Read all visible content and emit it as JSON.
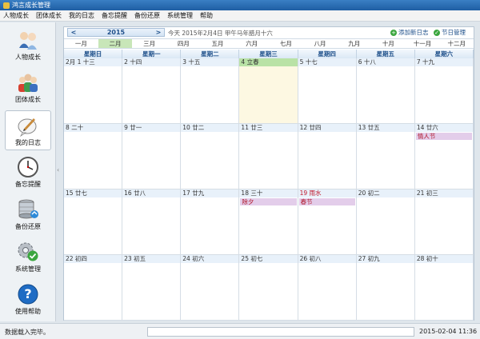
{
  "window": {
    "title": "鸿言成长管理"
  },
  "menu": [
    "人物成长",
    "团体成长",
    "我的日志",
    "备忘提醒",
    "备份还原",
    "系统管理",
    "帮助"
  ],
  "sidebar": [
    {
      "label": "人物成长",
      "icon": "person-icon"
    },
    {
      "label": "团体成长",
      "icon": "group-icon"
    },
    {
      "label": "我的日志",
      "icon": "diary-icon",
      "active": true
    },
    {
      "label": "备忘提醒",
      "icon": "clock-icon"
    },
    {
      "label": "备份还原",
      "icon": "database-icon"
    },
    {
      "label": "系统管理",
      "icon": "settings-icon"
    },
    {
      "label": "使用帮助",
      "icon": "help-icon"
    }
  ],
  "calendar": {
    "year": "2015",
    "prev": "<",
    "next": ">",
    "today_text": "今天 2015年2月4日 甲午马年腊月十六",
    "add_log": "添加新日志",
    "holiday_mgmt": "节日管理",
    "months": [
      "一月",
      "二月",
      "三月",
      "四月",
      "五月",
      "六月",
      "七月",
      "八月",
      "九月",
      "十月",
      "十一月",
      "十二月"
    ],
    "selected_month": 1,
    "weekdays": [
      "星期日",
      "星期一",
      "星期二",
      "星期三",
      "星期四",
      "星期五",
      "星期六"
    ],
    "weeks": [
      [
        {
          "d": "2月 1 十三"
        },
        {
          "d": "2 十四"
        },
        {
          "d": "3 十五"
        },
        {
          "d": "4 立春",
          "today": true
        },
        {
          "d": "5 十七"
        },
        {
          "d": "6 十八"
        },
        {
          "d": "7 十九"
        }
      ],
      [
        {
          "d": "8 二十"
        },
        {
          "d": "9 廿一"
        },
        {
          "d": "10 廿二"
        },
        {
          "d": "11 廿三"
        },
        {
          "d": "12 廿四"
        },
        {
          "d": "13 廿五"
        },
        {
          "d": "14 廿六",
          "event": "情人节"
        }
      ],
      [
        {
          "d": "15 廿七"
        },
        {
          "d": "16 廿八"
        },
        {
          "d": "17 廿九"
        },
        {
          "d": "18 三十",
          "event": "除夕"
        },
        {
          "d": "19 雨水",
          "fest": true,
          "event": "春节"
        },
        {
          "d": "20 初二"
        },
        {
          "d": "21 初三"
        }
      ],
      [
        {
          "d": "22 初四"
        },
        {
          "d": "23 初五"
        },
        {
          "d": "24 初六"
        },
        {
          "d": "25 初七"
        },
        {
          "d": "26 初八"
        },
        {
          "d": "27 初九"
        },
        {
          "d": "28 初十"
        }
      ]
    ]
  },
  "status": {
    "message": "数据载入完毕。",
    "datetime": "2015-02-04 11:36"
  },
  "colors": {
    "title_bar": "#2a6db4",
    "today_cell": "#fdf8e2",
    "selected_month": "#c8e6b8",
    "event": "#e3cdea"
  }
}
